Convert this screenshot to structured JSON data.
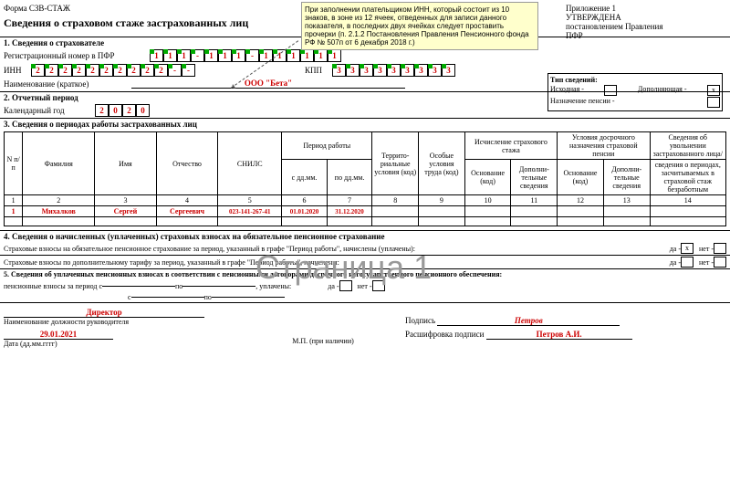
{
  "form_code": "Форма СЗВ-СТАЖ",
  "title": "Сведения о страховом стаже застрахованных лиц",
  "tooltip": "При заполнении плательщиком ИНН, который состоит из 10 знаков, в зоне из 12 ячеек, отведенных для записи данного показателя, в последних двух ячейках следует проставить прочерки (п. 2.1.2 Постановления Правления Пенсионного фонда РФ № 507п от 6 декабря 2018 г.)",
  "approve": {
    "l1": "Приложение 1",
    "l2": "УТВЕРЖДЕНА",
    "l3": "постановлением Правления",
    "l4": "ПФР"
  },
  "tip": {
    "h": "Тип сведений:",
    "a": "Исходная -",
    "b": "Дополняющая -",
    "x": "х",
    "c": "Назначение пенсии -"
  },
  "s1": {
    "h": "1. Сведения о страхователе",
    "reg": "Регистрационный номер в ПФР",
    "regnum": [
      "1",
      "1",
      "1",
      "-",
      "1",
      "1",
      "1",
      "-",
      "1",
      "1",
      "1",
      "1",
      "1",
      "1"
    ],
    "inn_l": "ИНН",
    "inn": [
      "2",
      "2",
      "2",
      "2",
      "2",
      "2",
      "2",
      "2",
      "2",
      "2",
      "-",
      "-"
    ],
    "kpp_l": "КПП",
    "kpp": [
      "3",
      "3",
      "3",
      "3",
      "3",
      "3",
      "3",
      "3",
      "3"
    ],
    "name_l": "Наименование (краткое)",
    "name": "ООО \"Бета\""
  },
  "s2": {
    "h": "2. Отчетный период",
    "yl": "Календарный год",
    "y": [
      "2",
      "0",
      "2",
      "0"
    ]
  },
  "s3": {
    "h": "3. Сведения о периодах работы застрахованных лиц",
    "hdr": [
      "N п/п",
      "Фамилия",
      "Имя",
      "Отчество",
      "СНИЛС",
      "Период работы",
      "Террито-риальные условия (код)",
      "Особые условия труда (код)",
      "Исчисление страхового стажа",
      "Условия досрочного назначения страховой пенсии",
      "Сведения об увольнении застрахованного лица/"
    ],
    "sub1": [
      "с дд.мм.",
      "по дд.мм."
    ],
    "sub2": [
      "Основание (код)",
      "Дополни-тельные сведения",
      "Основание (код)",
      "Дополни-тельные сведения"
    ],
    "sub3": "сведения о периодах, засчитываемых в страховой стаж безработным",
    "nums": [
      "1",
      "2",
      "3",
      "4",
      "5",
      "6",
      "7",
      "8",
      "9",
      "10",
      "11",
      "12",
      "13",
      "14"
    ],
    "row": {
      "n": "1",
      "f": "Михалков",
      "i": "Сергей",
      "o": "Сергеевич",
      "s": "023-141-267-41",
      "d1": "01.01.2020",
      "d2": "31.12.2020"
    }
  },
  "s4": {
    "h": "4. Сведения о начисленных (уплаченных) страховых взносах на обязательное пенсионное страхование",
    "l1": "Страховые взносы на обязательное пенсионное страхование за период, указанный в графе \"Период работы\", начислены (уплачены):",
    "l2": "Страховые взносы по дополнительному тарифу за период, указанный в графе \"Период работы\", начислены:",
    "da": "да -",
    "net": "нет -",
    "x": "х"
  },
  "s5": {
    "h": "5. Сведения об уплаченных пенсионных взносах в соответствии с пенсионными договорами досрочного негосударственного пенсионного обеспечения:",
    "l1": "пенсионные взносы за период с",
    "po": "по",
    "up": ", уплачены:",
    "da": "да -",
    "net": "нет -",
    "l2": "с",
    "po2": "по"
  },
  "sig": {
    "pos": "Директор",
    "posl": "Наименование должности руководителя",
    "date": "29.01.2021",
    "datel": "Дата (дд.мм.гггг)",
    "p": "Подпись",
    "pv": "Петров",
    "r": "Расшифровка подписи",
    "rv": "Петров А.И.",
    "mp": "М.П. (при наличии)"
  },
  "watermark": "Страница 1"
}
